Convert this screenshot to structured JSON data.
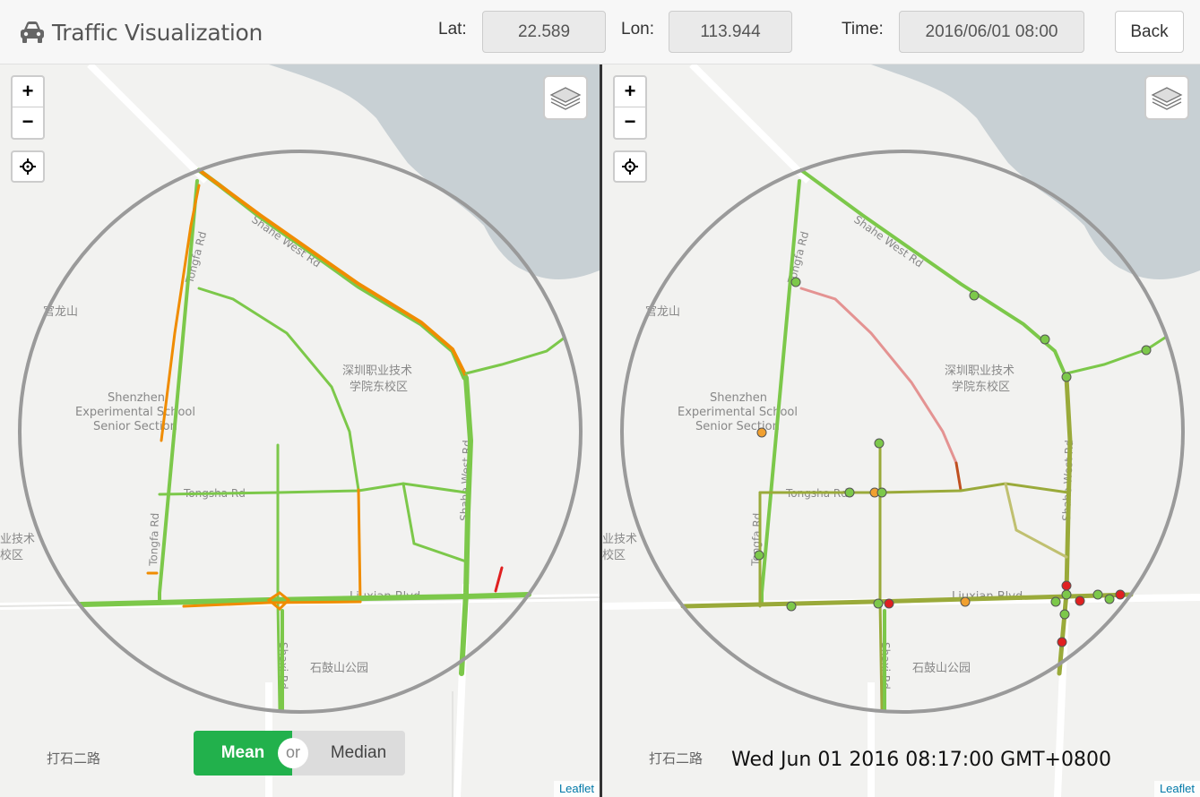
{
  "app": {
    "title": "Traffic Visualization",
    "icon": "car-icon"
  },
  "controls": {
    "lat_label": "Lat:",
    "lat_value": "22.589",
    "lon_label": "Lon:",
    "lon_value": "113.944",
    "time_label": "Time:",
    "time_value": "2016/06/01 08:00",
    "back_label": "Back"
  },
  "map_labels": {
    "shahe_west": "Shahe West Rd",
    "tongfa": "Tongfa Rd",
    "tongsha": "Tongsha Rd",
    "liuxian": "Liuxian Blvd",
    "shaxi": "Shaxi Rd",
    "college_line1": "深圳职业技术",
    "college_line2": "学院东校区",
    "school_line1": "Shenzhen",
    "school_line2": "Experimental School",
    "school_line3": "Senior Section",
    "park": "石鼓山公园",
    "mountain": "官龙山",
    "road_dashi": "打石二路",
    "edge_line1": "业技术",
    "edge_line2": "校区"
  },
  "left_map": {
    "attribution": "Leaflet",
    "zoom_in": "+",
    "zoom_out": "−",
    "layers_icon": "layers-icon",
    "locate_icon": "crosshair-icon"
  },
  "right_map": {
    "attribution": "Leaflet",
    "zoom_in": "+",
    "zoom_out": "−",
    "layers_icon": "layers-icon",
    "locate_icon": "crosshair-icon",
    "timestamp": "Wed Jun 01 2016 08:17:00 GMT+0800"
  },
  "toggle": {
    "mean": "Mean",
    "or": "or",
    "median": "Median",
    "selected": "mean"
  },
  "colors": {
    "fast": "#7cc84a",
    "medium": "#f08c00",
    "slow": "#e02020",
    "mixed": "#9aaa3a",
    "water": "#c8d0d4",
    "circle": "#9a9a9a"
  }
}
